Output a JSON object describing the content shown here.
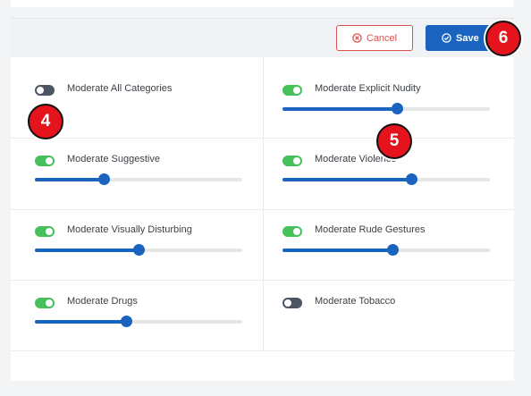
{
  "toolbar": {
    "cancel_label": "Cancel",
    "cancel_icon": "cancel-circle-icon",
    "save_label": "Save",
    "save_icon": "check-circle-icon",
    "colors": {
      "cancel": "#d9534f",
      "save": "#1a64c0"
    }
  },
  "settings": [
    {
      "label": "Moderate All Categories",
      "enabled": false,
      "has_slider": false
    },
    {
      "label": "Moderate Explicit Nudity",
      "enabled": true,
      "has_slider": true,
      "level": 0.55
    },
    {
      "label": "Moderate Suggestive",
      "enabled": true,
      "has_slider": true,
      "level": 0.33
    },
    {
      "label": "Moderate Violence",
      "enabled": true,
      "has_slider": true,
      "level": 0.62
    },
    {
      "label": "Moderate Visually Disturbing",
      "enabled": true,
      "has_slider": true,
      "level": 0.5
    },
    {
      "label": "Moderate Rude Gestures",
      "enabled": true,
      "has_slider": true,
      "level": 0.53
    },
    {
      "label": "Moderate Drugs",
      "enabled": true,
      "has_slider": true,
      "level": 0.44
    },
    {
      "label": "Moderate Tobacco",
      "enabled": false,
      "has_slider": false
    }
  ],
  "annotations": [
    "4",
    "5",
    "6"
  ],
  "colors": {
    "toggle_on": "#45c05a",
    "toggle_off": "#4b5563",
    "slider": "#1a64c0",
    "badge": "#e4131c"
  }
}
